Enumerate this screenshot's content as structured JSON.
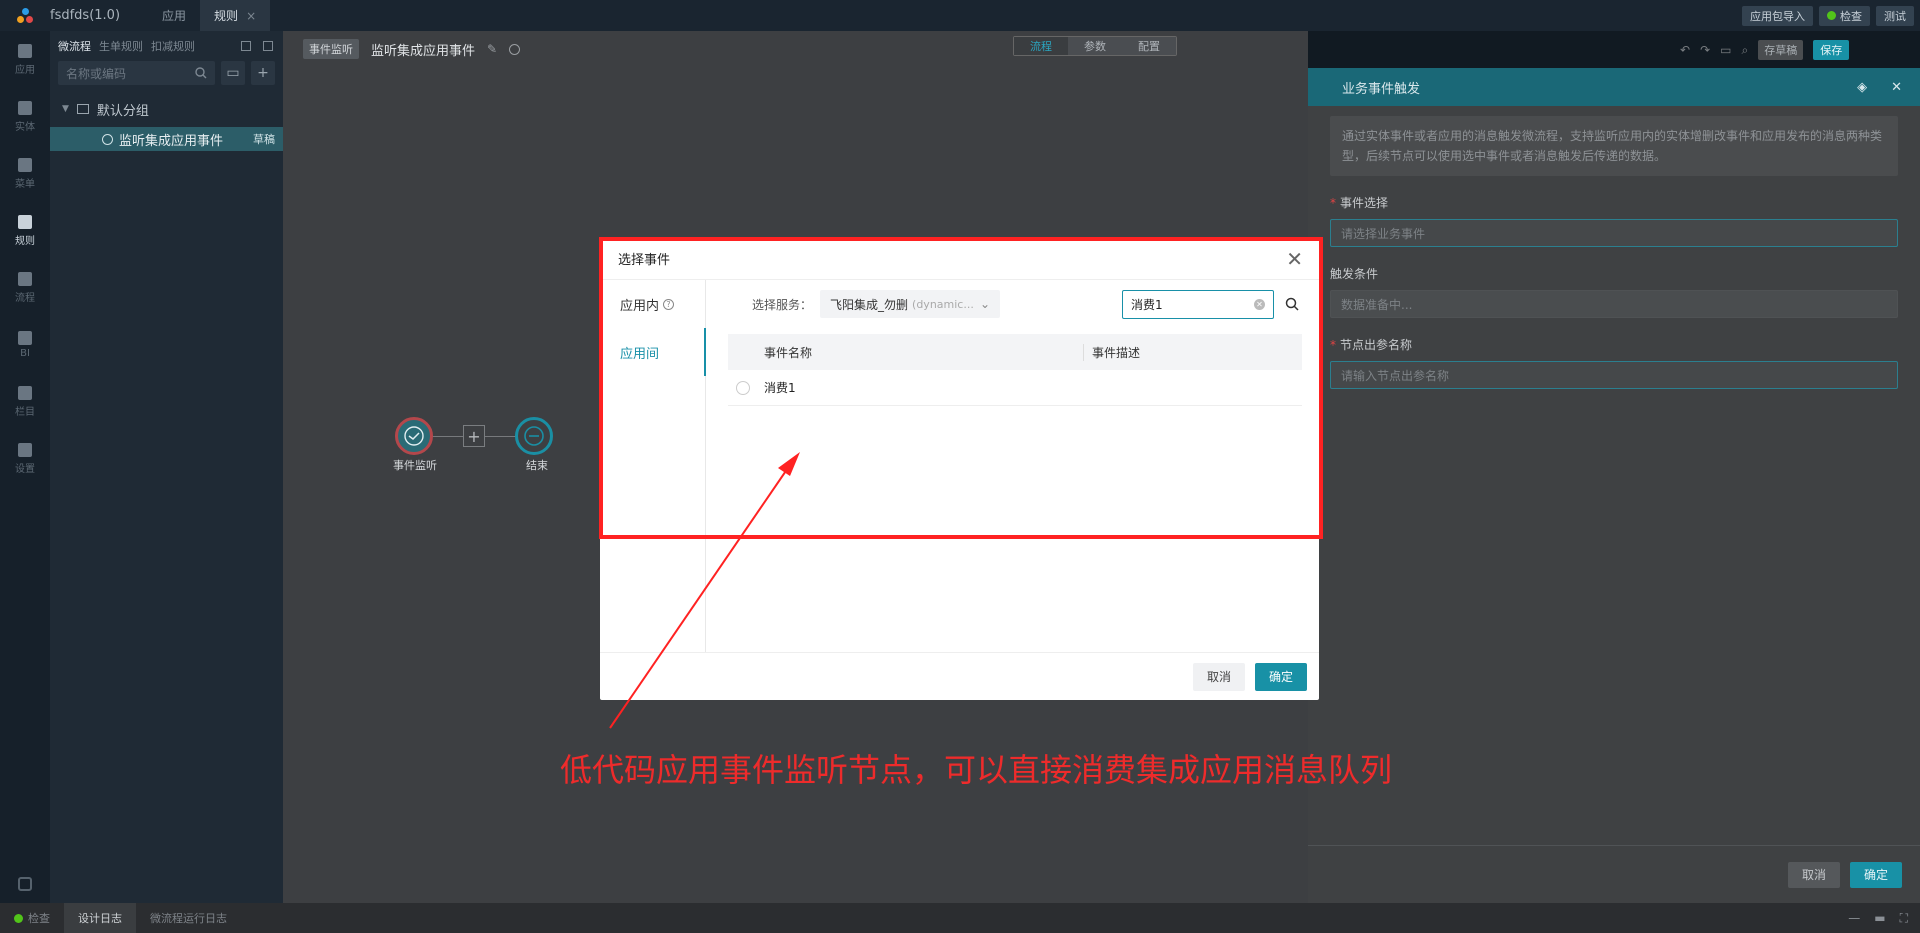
{
  "app": {
    "title": "fsdfds(1.0)"
  },
  "top_tabs": [
    {
      "label": "应用"
    },
    {
      "label": "规则",
      "close": "×"
    }
  ],
  "top_actions": {
    "import": "应用包导入",
    "check": "检查",
    "test": "测试"
  },
  "rail": [
    {
      "label": "应用",
      "icon": "app-icon"
    },
    {
      "label": "实体",
      "icon": "entity-icon"
    },
    {
      "label": "菜单",
      "icon": "menu-icon"
    },
    {
      "label": "规则",
      "icon": "rule-icon"
    },
    {
      "label": "流程",
      "icon": "flow-icon"
    },
    {
      "label": "BI",
      "icon": "bi-icon"
    },
    {
      "label": "栏目",
      "icon": "column-icon"
    },
    {
      "label": "设置",
      "icon": "settings-icon"
    }
  ],
  "tree": {
    "tabs": [
      "微流程",
      "生单规则",
      "扣减规则"
    ],
    "search_placeholder": "名称或编码",
    "group": "默认分组",
    "leaf": {
      "label": "监听集成应用事件",
      "badge": "草稿"
    }
  },
  "canvas": {
    "crumb_tag": "事件监听",
    "title": "监听集成应用事件",
    "segments": [
      "流程",
      "参数",
      "配置"
    ],
    "save_draft": "存草稿",
    "save": "保存",
    "nodes": {
      "start": "事件监听",
      "end": "结束"
    }
  },
  "right_panel": {
    "title": "业务事件触发",
    "description": "通过实体事件或者应用的消息触发微流程，支持监听应用内的实体增删改事件和应用发布的消息两种类型，后续节点可以使用选中事件或者消息触发后传递的数据。",
    "event_label": "事件选择",
    "event_placeholder": "请选择业务事件",
    "condition_label": "触发条件",
    "condition_value": "数据准备中...",
    "output_label": "节点出参名称",
    "output_placeholder": "请输入节点出参名称",
    "cancel": "取消",
    "ok": "确定"
  },
  "modal": {
    "title": "选择事件",
    "side": [
      {
        "label": "应用内"
      },
      {
        "label": "应用间"
      }
    ],
    "service_label": "选择服务：",
    "service_value": "飞阳集成_勿删",
    "service_sub": "(dynamic...",
    "search_value": "消费1",
    "columns": [
      "事件名称",
      "事件描述"
    ],
    "rows": [
      {
        "name": "消费1",
        "desc": ""
      }
    ],
    "cancel": "取消",
    "ok": "确定"
  },
  "statusbar": {
    "check": "检查",
    "design_log": "设计日志",
    "run_log": "微流程运行日志"
  },
  "annotation": {
    "text": "低代码应用事件监听节点，可以直接消费集成应用消息队列",
    "color": "#ee2b2b"
  },
  "colors": {
    "accent": "#1891a6",
    "annotation": "#ff2222"
  }
}
